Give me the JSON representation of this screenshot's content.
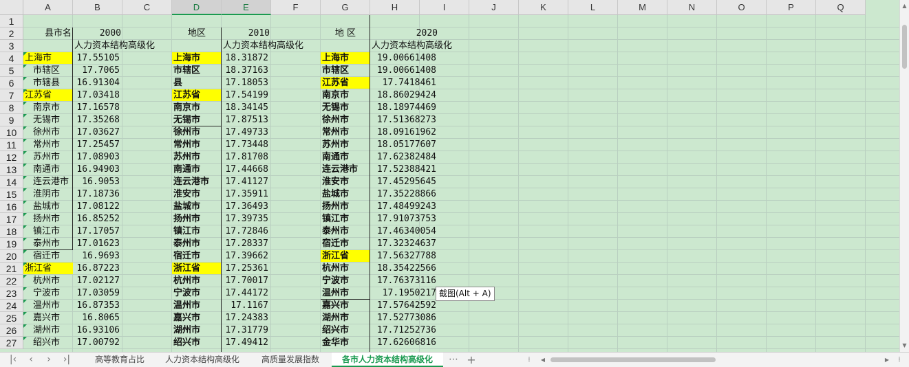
{
  "columns": [
    "A",
    "B",
    "C",
    "D",
    "E",
    "F",
    "G",
    "H",
    "I",
    "J",
    "K",
    "L",
    "M",
    "N",
    "O",
    "P",
    "Q"
  ],
  "row_numbers": [
    "1",
    "2",
    "3",
    "4",
    "5",
    "6",
    "7",
    "8",
    "9",
    "10",
    "11",
    "12",
    "13",
    "14",
    "15",
    "16",
    "17",
    "18",
    "19",
    "20",
    "21",
    "22",
    "23",
    "24",
    "25",
    "26",
    "27"
  ],
  "headers": {
    "a2": "县市名",
    "b2": "2000",
    "b3": "人力资本结构高级化",
    "d2": "地区",
    "e2": "2010",
    "e3": "人力资本结构高级化",
    "g2": "地  区",
    "h2": "2020",
    "h3": "人力资本结构高级化"
  },
  "col_a": [
    "上海市",
    "市辖区",
    "市辖县",
    "江苏省",
    "南京市",
    "无锡市",
    "徐州市",
    "常州市",
    "苏州市",
    "南通市",
    "连云港市",
    "淮阴市",
    "盐城市",
    "扬州市",
    "镇江市",
    "泰州市",
    "宿迁市",
    "浙江省",
    "杭州市",
    "宁波市",
    "温州市",
    "嘉兴市",
    "湖州市",
    "绍兴市"
  ],
  "col_b": [
    "17.55105",
    "17.7065",
    "16.91304",
    "17.03418",
    "17.16578",
    "17.35268",
    "17.03627",
    "17.25457",
    "17.08903",
    "16.94903",
    "16.9053",
    "17.18736",
    "17.08122",
    "16.85252",
    "17.17057",
    "17.01623",
    "16.9693",
    "16.87223",
    "17.02127",
    "17.03059",
    "16.87353",
    "16.8065",
    "16.93106",
    "17.00792"
  ],
  "col_d": [
    "上海市",
    "市辖区",
    "县",
    "江苏省",
    "南京市",
    "无锡市",
    "徐州市",
    "常州市",
    "苏州市",
    "南通市",
    "连云港市",
    "淮安市",
    "盐城市",
    "扬州市",
    "镇江市",
    "泰州市",
    "宿迁市",
    "浙江省",
    "杭州市",
    "宁波市",
    "温州市",
    "嘉兴市",
    "湖州市",
    "绍兴市"
  ],
  "col_e": [
    "18.31872",
    "18.37163",
    "17.18053",
    "17.54199",
    "18.34145",
    "17.87513",
    "17.49733",
    "17.73448",
    "17.81708",
    "17.44668",
    "17.41127",
    "17.35911",
    "17.36493",
    "17.39735",
    "17.72846",
    "17.28337",
    "17.39662",
    "17.25361",
    "17.70017",
    "17.44172",
    "17.1167",
    "17.24383",
    "17.31779",
    "17.49412"
  ],
  "col_g": [
    "上海市",
    "市辖区",
    "江苏省",
    "南京市",
    "无锡市",
    "徐州市",
    "常州市",
    "苏州市",
    "南通市",
    "连云港市",
    "淮安市",
    "盐城市",
    "扬州市",
    "镇江市",
    "泰州市",
    "宿迁市",
    "浙江省",
    "杭州市",
    "宁波市",
    "温州市",
    "嘉兴市",
    "湖州市",
    "绍兴市",
    "金华市"
  ],
  "col_h": [
    "19.00661408",
    "19.00661408",
    "17.7418461",
    "18.86029424",
    "18.18974469",
    "17.51368273",
    "18.09161962",
    "18.05177607",
    "17.62382484",
    "17.52388421",
    "17.45295645",
    "17.35228866",
    "17.48499243",
    "17.91073753",
    "17.46340054",
    "17.32324637",
    "17.56327788",
    "18.35422566",
    "17.76373116",
    "17.1950217",
    "17.57642592",
    "17.52773086",
    "17.71252736",
    "17.62606816"
  ],
  "highlight_rows": {
    "a": [
      0,
      3,
      17
    ],
    "d": [
      0,
      3,
      17
    ],
    "g": [
      0,
      2,
      16
    ]
  },
  "tooltip": "截图(Alt + A)",
  "tabs": [
    "高等教育占比",
    "人力资本结构高级化",
    "高质量发展指数",
    "各市人力资本结构高级化"
  ],
  "active_tab": 3,
  "more_tabs_icon": "⋯",
  "add_tab_icon": "+",
  "colors": {
    "sheet_bg": "#cce8cf",
    "highlight": "#ffff00",
    "accent": "#1a9a50"
  }
}
